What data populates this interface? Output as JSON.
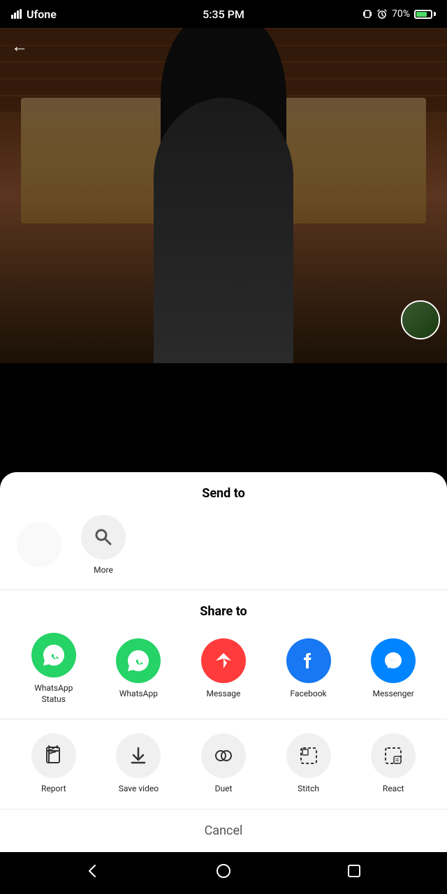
{
  "statusBar": {
    "carrier": "Ufone",
    "time": "5:35 PM",
    "battery": "70%"
  },
  "header": {
    "backLabel": "←"
  },
  "sheet": {
    "sendToLabel": "Send to",
    "shareToLabel": "Share to",
    "cancelLabel": "Cancel",
    "moreLabel": "More"
  },
  "shareApps": [
    {
      "id": "whatsapp-status",
      "label": "WhatsApp\nStatus",
      "type": "whatsapp-green"
    },
    {
      "id": "whatsapp",
      "label": "WhatsApp",
      "type": "whatsapp-green"
    },
    {
      "id": "message",
      "label": "Message",
      "type": "message-red"
    },
    {
      "id": "facebook",
      "label": "Facebook",
      "type": "facebook-blue"
    },
    {
      "id": "messenger",
      "label": "Messenger",
      "type": "messenger-blue"
    }
  ],
  "actionButtons": [
    {
      "id": "report",
      "label": "Report"
    },
    {
      "id": "save-video",
      "label": "Save video"
    },
    {
      "id": "duet",
      "label": "Duet"
    },
    {
      "id": "stitch",
      "label": "Stitch"
    },
    {
      "id": "react",
      "label": "React"
    }
  ]
}
